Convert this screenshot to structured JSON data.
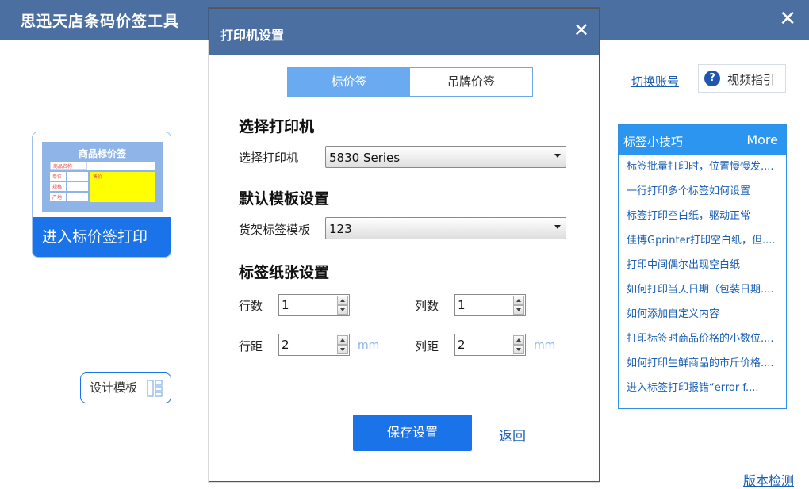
{
  "app": {
    "title": "思迅天店条码价签工具",
    "price_card": {
      "thumb_title": "商品标价签",
      "thumb_fields": [
        "商品名称",
        "单位",
        "规格",
        "产地"
      ],
      "thumb_price": "售价",
      "label": "进入标价签打印"
    },
    "design_template_label": "设计模板",
    "switch_account_label": "切换账号",
    "video_guide_label": "视频指引",
    "tips": {
      "title": "标签小技巧",
      "more_label": "More",
      "items": [
        "标签批量打印时，位置慢慢发....",
        "一行打印多个标签如何设置",
        "标签打印空白纸，驱动正常",
        "佳博Gprinter打印空白纸，但....",
        "打印中间偶尔出现空白纸",
        "如何打印当天日期（包装日期....",
        "如何添加自定义内容",
        "打印标签时商品价格的小数位....",
        "如何打印生鲜商品的市斤价格....",
        "进入标签打印报错“error f...."
      ]
    },
    "version_check_label": "版本检测"
  },
  "dialog": {
    "title": "打印机设置",
    "tabs": [
      {
        "label": "标价签",
        "active": true
      },
      {
        "label": "吊牌价签",
        "active": false
      }
    ],
    "printer_section": {
      "heading": "选择打印机",
      "label": "选择打印机",
      "value": "5830 Series"
    },
    "template_section": {
      "heading": "默认模板设置",
      "label": "货架标签模板",
      "value": "123"
    },
    "paper_section": {
      "heading": "标签纸张设置",
      "rows_label": "行数",
      "rows_value": "1",
      "cols_label": "列数",
      "cols_value": "1",
      "row_gap_label": "行距",
      "row_gap_value": "2",
      "col_gap_label": "列距",
      "col_gap_value": "2",
      "unit": "mm"
    },
    "save_label": "保存设置",
    "back_label": "返回"
  },
  "colors": {
    "header": "#4a6fa0",
    "primary": "#1a73e8",
    "link": "#1a5fb4",
    "tab_active": "#6aaaf0",
    "tips_header": "#2b95f0"
  }
}
